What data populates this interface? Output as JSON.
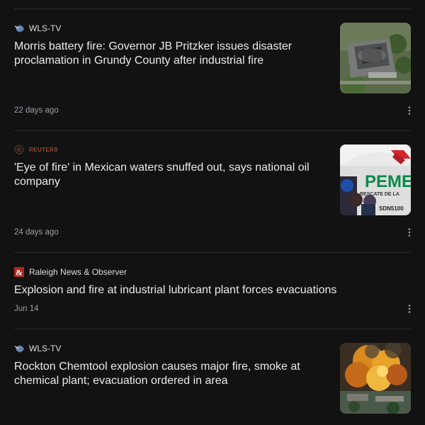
{
  "articles": [
    {
      "source": "WLS-TV",
      "source_icon": "abc7-globe-icon",
      "headline_line1": "Morris battery fire: Governor JB Pritzker issues disaster",
      "headline_line2": "proclamation in Grundy County after industrial fire",
      "time": "22 days ago",
      "thumbnail": "aerial-industrial-fire-image"
    },
    {
      "source": "REUTERS",
      "source_icon": "reuters-logo-icon",
      "headline_line1": "'Eye of fire' in Mexican waters snuffed out, says national oil",
      "headline_line2": "company",
      "time": "24 days ago",
      "thumbnail": "pemex-ship-image",
      "thumbnail_text": {
        "brand": "PEME",
        "rescue": "RESCATE DE LA",
        "code": "SDN5100"
      }
    },
    {
      "source": "Raleigh News & Observer",
      "source_icon": "ampersand-logo-icon",
      "headline_line1": "Explosion and fire at industrial lubricant plant forces evacuations",
      "time": "Jun 14"
    },
    {
      "source": "WLS-TV",
      "source_icon": "abc7-globe-icon",
      "headline_line1": "Rockton Chemtool explosion causes major fire, smoke at",
      "headline_line2": "chemical plant; evacuation ordered in area",
      "thumbnail": "chemical-plant-explosion-image"
    }
  ],
  "colors": {
    "background": "#121212",
    "headline": "#eaeaea",
    "meta": "#9aa0a6",
    "divider": "#2c2c2c",
    "raleigh_red": "#b3261e",
    "pemex_green": "#0a8a4a"
  }
}
